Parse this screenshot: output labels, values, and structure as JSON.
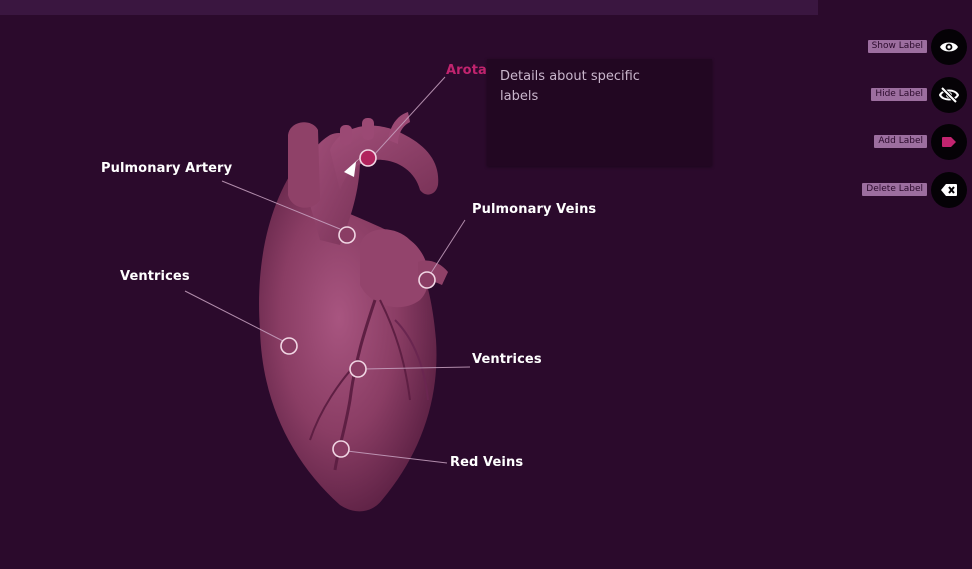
{
  "labels": {
    "arota": "Arota",
    "pulmonary_artery": "Pulmonary Artery",
    "pulmonary_veins": "Pulmonary Veins",
    "ventrices_left": "Ventrices",
    "ventrices_right": "Ventrices",
    "red_veins": "Red Veins"
  },
  "details": {
    "text": "Details about specific labels"
  },
  "tools": [
    {
      "label": "Show Label",
      "icon": "eye-icon"
    },
    {
      "label": "Hide Label",
      "icon": "eye-off-icon"
    },
    {
      "label": "Add Label",
      "icon": "tag-icon"
    },
    {
      "label": "Delete Label",
      "icon": "backspace-icon"
    }
  ],
  "colors": {
    "background": "#2b0a2c",
    "accent": "#c2246f",
    "heart": "#8a3d64",
    "chip": "#9c6e9f"
  }
}
